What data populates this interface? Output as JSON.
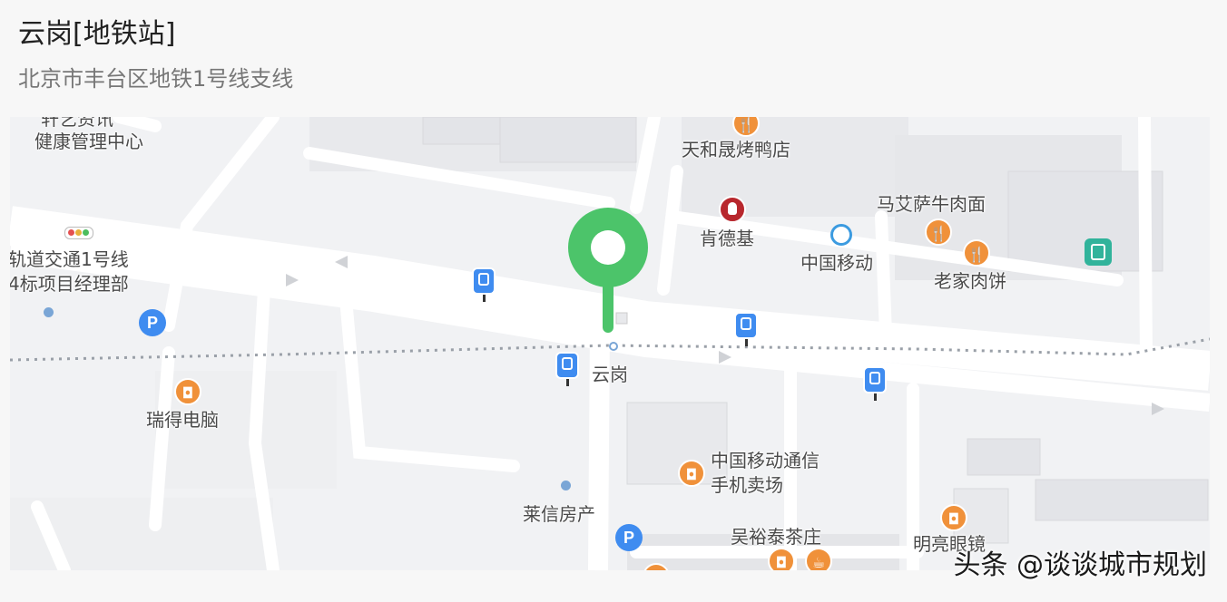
{
  "header": {
    "title": "云岗[地铁站]",
    "subtitle": "北京市丰台区地铁1号线支线"
  },
  "map": {
    "selected_station": "云岗",
    "labels": {
      "health_center_top": "轩艺资讯",
      "health_center": "健康管理中心",
      "roast_duck": "天和晟烤鸭店",
      "beef_noodle": "马艾萨牛肉面",
      "kfc": "肯德基",
      "china_mobile": "中国移动",
      "meat_pie": "老家肉饼",
      "rail_project_1": "轨道交通1号线",
      "rail_project_2": "4标项目经理部",
      "station_name": "云岗",
      "ruide_computer": "瑞得电脑",
      "mobile_store_1": "中国移动通信",
      "mobile_store_2": "手机卖场",
      "realty": "莱信房产",
      "tea_house": "吴裕泰茶庄",
      "glasses": "明亮眼镜"
    },
    "icons": {
      "pin": "location-pin-icon",
      "bus": "bus-stop-icon",
      "parking": "parking-icon",
      "shop": "shopping-icon",
      "food": "restaurant-icon",
      "metro": "metro-icon",
      "kfc": "kfc-logo-icon",
      "china_mobile": "china-mobile-logo-icon",
      "traffic_light": "traffic-light-icon"
    },
    "parking_glyph": "P",
    "colors": {
      "pin": "#4cc46a",
      "bus": "#3f8cf0",
      "poi": "#f0913a",
      "metro": "#31b39b"
    }
  },
  "watermark": "头条 @谈谈城市规划"
}
